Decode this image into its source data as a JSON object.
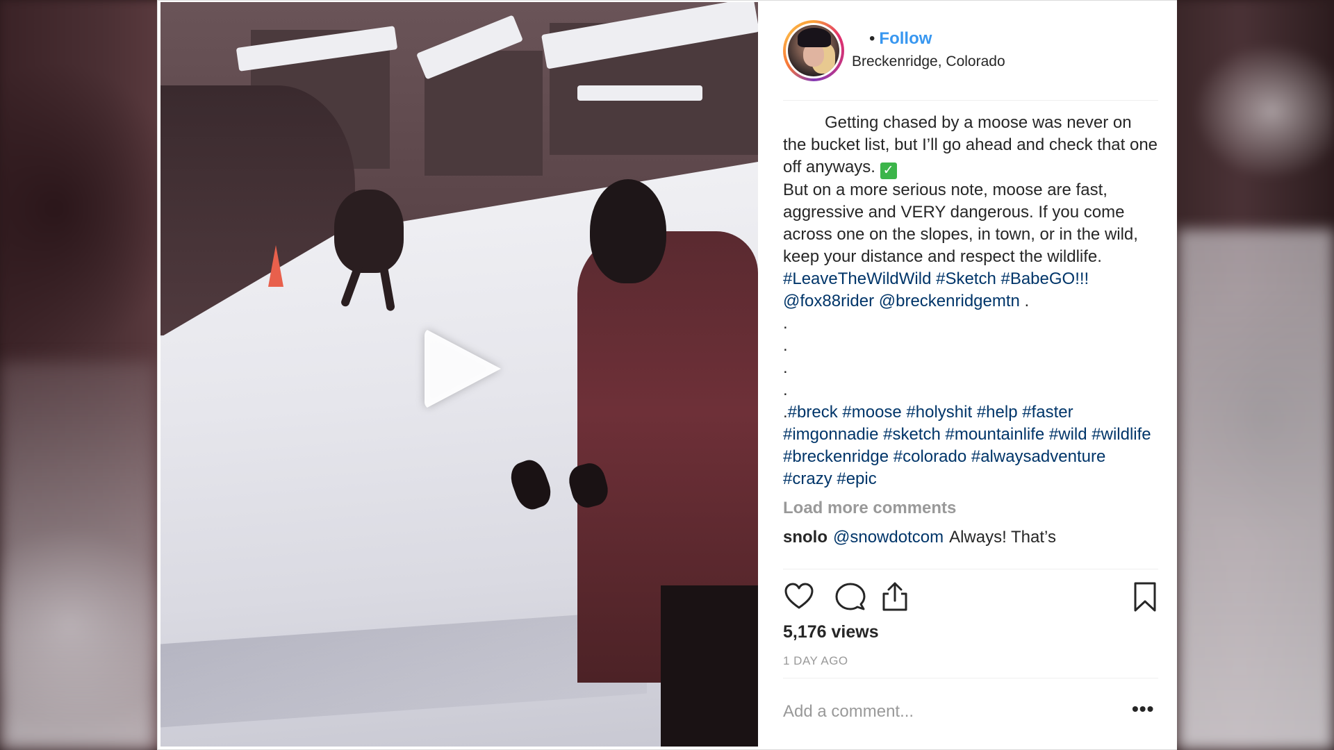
{
  "post": {
    "follow_label": "Follow",
    "location": "Breckenridge, Colorado",
    "caption": {
      "line1": "Getting chased by a moose was never on the bucket list, but I’ll go ahead and check that one off anyways. ",
      "check_emoji": "✓",
      "line2": "\nBut on a more serious note, moose are fast, aggressive and VERY dangerous. If you come across one on the slopes, in town, or in the wild, keep your distance and respect the wildlife. ",
      "tags1": "#LeaveTheWildWild #Sketch #BabeGO!!! @fox88rider @breckenridgemtn",
      "after_tags1": " .\n.\n.\n.\n.",
      "tags2": "#breck #moose #holyshit #help #faster #imgonnadie #sketch #mountainlife #wild #wildlife #breckenridge #colorado #alwaysadventure #crazy #epic"
    },
    "load_more_label": "Load more comments",
    "peek_comment": {
      "user": "snolo",
      "mention": "@snowdotcom",
      "text": "Always! That’s"
    },
    "views": "5,176 views",
    "time_ago": "1 DAY AGO",
    "add_comment_placeholder": "Add a comment...",
    "more_label": "•••"
  },
  "icons": {
    "like": "heart-icon",
    "comment": "comment-bubble-icon",
    "share": "share-upload-icon",
    "save": "bookmark-icon",
    "play": "play-icon"
  },
  "colors": {
    "link_blue": "#3897f0",
    "hashtag": "#003569",
    "muted": "#999999",
    "text": "#262626"
  }
}
